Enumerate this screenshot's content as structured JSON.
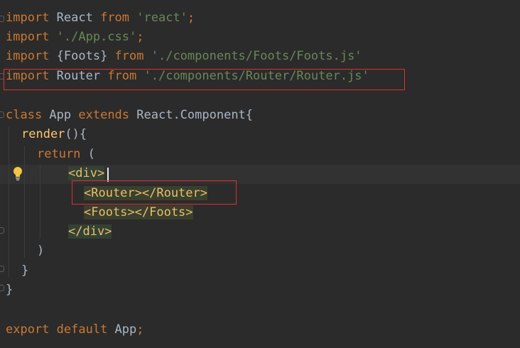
{
  "editor": {
    "language": "javascript-jsx",
    "colors": {
      "background": "#2b2b2b",
      "keyword": "#cc7832",
      "string": "#6a8759",
      "plain": "#a9b7c6",
      "function": "#ffc66d",
      "tag": "#e8bf6a",
      "highlight_border": "#e0302f"
    },
    "lines": [
      {
        "kw1": "import",
        "plain": " React ",
        "kw2": "from",
        "str": " 'react'",
        "tail": ";"
      },
      {
        "kw": "import",
        "str": " './App.css'",
        "tail": ";"
      },
      {
        "kw1": "import",
        "plain": " {Foots} ",
        "kw2": "from",
        "str": " './components/Foots/Foots.js'"
      },
      {
        "kw1": "import",
        "plain": " Router ",
        "kw2": "from",
        "str": " './components/Router/Router.js'"
      },
      {
        "kw1": "class",
        "plain1": " App ",
        "kw2": "extends",
        "plain2": " React.Component{"
      },
      {
        "fn": "render",
        "plain": "(){"
      },
      {
        "kw": "return",
        "plain": " ("
      },
      {
        "tag": "<div>"
      },
      {
        "tag": "<Router></Router>"
      },
      {
        "tag": "<Foots></Foots>"
      },
      {
        "tag": "</div>"
      },
      {
        "plain": ")"
      },
      {
        "plain": "}"
      },
      {
        "plain": "}"
      },
      {
        "kw1": "export",
        "kw2": " default",
        "plain": " App",
        "tail": ";"
      }
    ]
  }
}
